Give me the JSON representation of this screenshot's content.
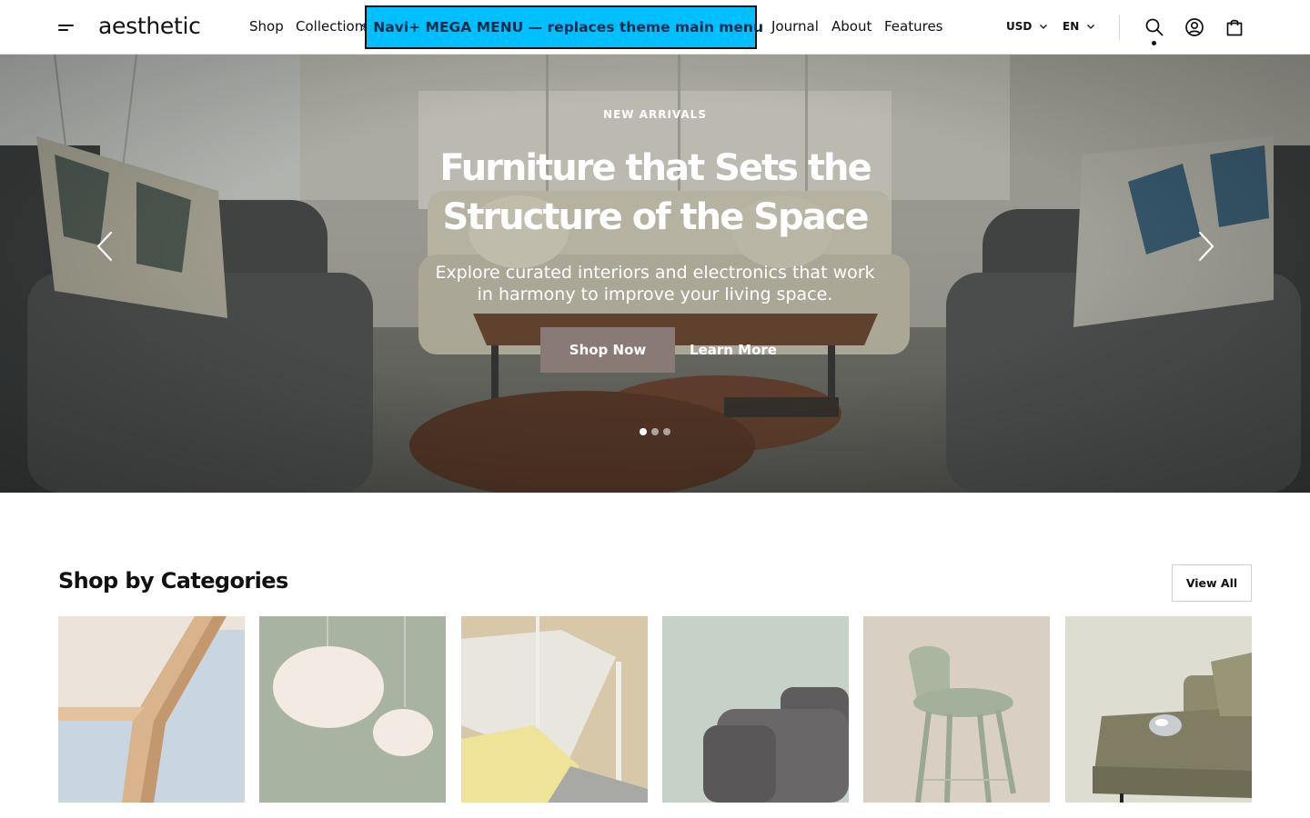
{
  "header": {
    "logo": "aesthetic",
    "nav": [
      {
        "label": "Shop"
      },
      {
        "label": "Collections"
      },
      {
        "label": "Journal"
      },
      {
        "label": "About"
      },
      {
        "label": "Features"
      }
    ],
    "mega_menu_label": "⚡ Navi+ MEGA MENU — replaces theme main menu",
    "currency": "USD",
    "language": "EN",
    "icons": [
      "menu-icon",
      "search-icon",
      "account-icon",
      "cart-icon",
      "chevron-down-icon"
    ]
  },
  "hero": {
    "eyebrow": "NEW ARRIVALS",
    "title": "Furniture that Sets the Structure of the Space",
    "subtitle": "Explore curated interiors and electronics that work in harmony to improve your living space.",
    "primary_button": "Shop Now",
    "secondary_button": "Learn More",
    "slide_count": 3,
    "active_slide": 1,
    "icons": [
      "chevron-left-icon",
      "chevron-right-icon"
    ]
  },
  "categories": {
    "title": "Shop by Categories",
    "view_all_label": "View All"
  },
  "colors": {
    "accent_button": "#8a7a76",
    "mega_menu_bg": "#00bfff"
  }
}
